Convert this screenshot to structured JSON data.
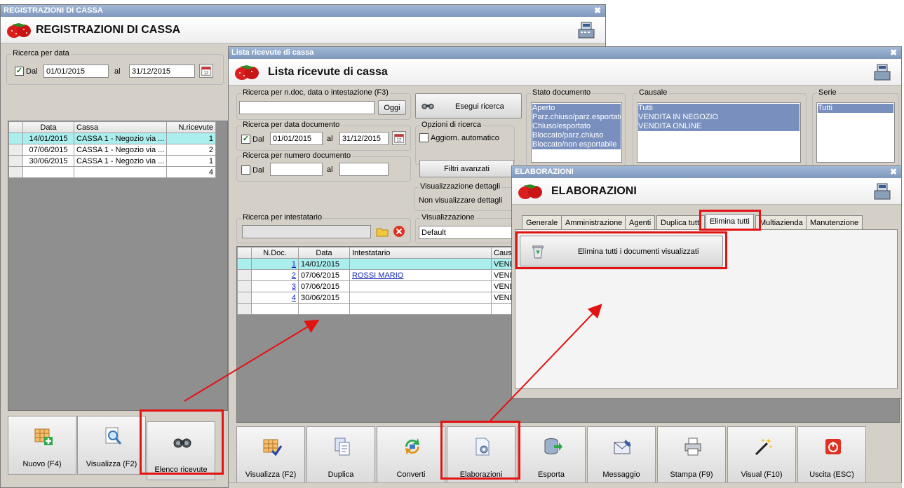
{
  "win1": {
    "titlebar": "REGISTRAZIONI DI CASSA",
    "header_title": "REGISTRAZIONI DI CASSA",
    "group_label": "Ricerca per data",
    "dal_label": "Dal",
    "date_from": "01/01/2015",
    "al_label": "al",
    "date_to": "31/12/2015",
    "table": {
      "headers": [
        "Data",
        "Cassa",
        "N.ricevute"
      ],
      "rows": [
        [
          "14/01/2015",
          "CASSA 1 - Negozio via ...",
          "1"
        ],
        [
          "07/06/2015",
          "CASSA 1 - Negozio via ...",
          "2"
        ],
        [
          "30/06/2015",
          "CASSA 1 - Negozio via ...",
          "1"
        ]
      ],
      "total": "4"
    },
    "toolbar": [
      "Nuovo (F4)",
      "Visualizza (F2)",
      "Elenco ricevute"
    ]
  },
  "win2": {
    "titlebar": "Lista ricevute di cassa",
    "header_title": "Lista ricevute di cassa",
    "g_ndoc": "Ricerca per n.doc, data o intestazione (F3)",
    "oggi": "Oggi",
    "esegui": "Esegui ricerca",
    "g_datadoc": "Ricerca per data documento",
    "dal": "Dal",
    "al": "al",
    "date_from": "01/01/2015",
    "date_to": "31/12/2015",
    "g_numdoc": "Ricerca per numero documento",
    "g_opzioni": "Opzioni di ricerca",
    "aggiorn": "Aggiorn. automatico",
    "filtri": "Filtri avanzati",
    "g_visdet": "Visualizzazione dettagli",
    "visdet_value": "Non visualizzare dettagli",
    "g_intest": "Ricerca per intestatario",
    "g_vis": "Visualizzazione",
    "vis_value": "Default",
    "g_stato": "Stato documento",
    "stato_items": [
      "Aperto",
      "Parz.chiuso/parz.esportato",
      "Chiuso/esportato",
      "Bloccato/parz.chiuso",
      "Bloccato/non esportabile"
    ],
    "g_causale": "Causale",
    "causale_items": [
      "Tutti",
      "VENDITA IN NEGOZIO",
      "VENDITA ONLINE"
    ],
    "g_serie": "Serie",
    "serie_items": [
      "Tutti"
    ],
    "table": {
      "headers": [
        "N.Doc.",
        "Data",
        "Intestatario",
        "Causa"
      ],
      "rows": [
        [
          "1",
          "14/01/2015",
          "",
          "VENDI"
        ],
        [
          "2",
          "07/06/2015",
          "ROSSI MARIO",
          "VENDI"
        ],
        [
          "3",
          "07/06/2015",
          "",
          "VENDI"
        ],
        [
          "4",
          "30/06/2015",
          "",
          "VENDI"
        ]
      ]
    },
    "toolbar": [
      "Visualizza (F2)",
      "Duplica",
      "Converti",
      "Elaborazioni",
      "Esporta",
      "Messaggio",
      "Stampa (F9)",
      "Visual (F10)",
      "Uscita (ESC)"
    ]
  },
  "win3": {
    "titlebar": "ELABORAZIONI",
    "header_title": "ELABORAZIONI",
    "tabs": [
      "Generale",
      "Amministrazione",
      "Agenti",
      "Duplica tutti",
      "Elimina tutti",
      "Multiazienda",
      "Manutenzione"
    ],
    "action_button": "Elimina tutti i documenti visualizzati"
  },
  "colors": {
    "highlight": "#e21313",
    "selected_row": "#aaeeee",
    "list_selection": "#7990bf",
    "titlebar": "#8aa2c8"
  }
}
